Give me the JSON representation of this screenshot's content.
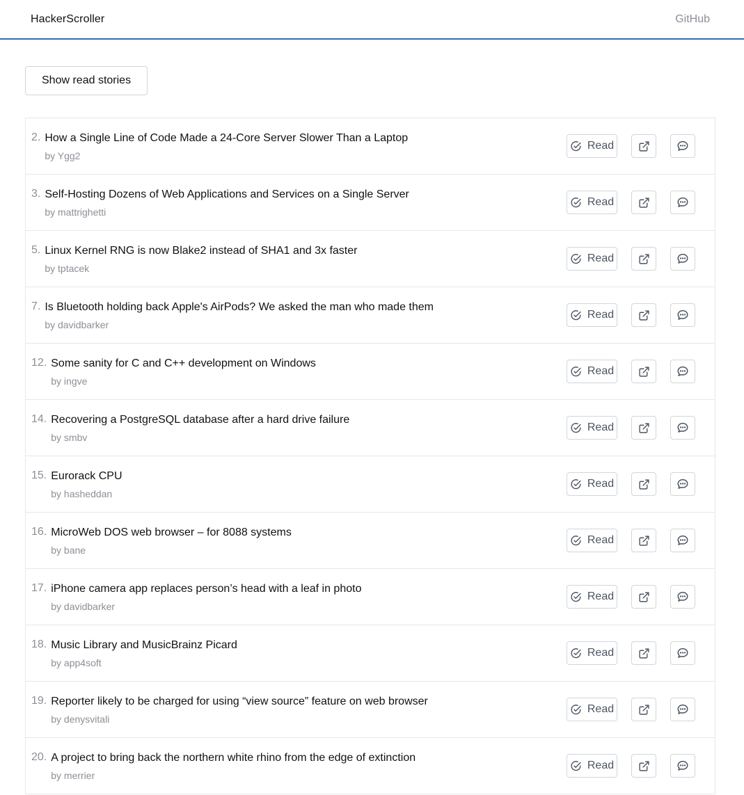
{
  "header": {
    "brand": "HackerScroller",
    "github_label": "GitHub"
  },
  "toolbar": {
    "toggle_label": "Show read stories"
  },
  "actions": {
    "read_label": "Read"
  },
  "stories": [
    {
      "rank": "2.",
      "title": "How a Single Line of Code Made a 24-Core Server Slower Than a Laptop",
      "author": "by Ygg2"
    },
    {
      "rank": "3.",
      "title": "Self-Hosting Dozens of Web Applications and Services on a Single Server",
      "author": "by mattrighetti"
    },
    {
      "rank": "5.",
      "title": "Linux Kernel RNG is now Blake2 instead of SHA1 and 3x faster",
      "author": "by tptacek"
    },
    {
      "rank": "7.",
      "title": "Is Bluetooth holding back Apple's AirPods? We asked the man who made them",
      "author": "by davidbarker"
    },
    {
      "rank": "12.",
      "title": "Some sanity for C and C++ development on Windows",
      "author": "by ingve"
    },
    {
      "rank": "14.",
      "title": "Recovering a PostgreSQL database after a hard drive failure",
      "author": "by smbv"
    },
    {
      "rank": "15.",
      "title": "Eurorack CPU",
      "author": "by hasheddan"
    },
    {
      "rank": "16.",
      "title": "MicroWeb DOS web browser – for 8088 systems",
      "author": "by bane"
    },
    {
      "rank": "17.",
      "title": "iPhone camera app replaces person’s head with a leaf in photo",
      "author": "by davidbarker"
    },
    {
      "rank": "18.",
      "title": "Music Library and MusicBrainz Picard",
      "author": "by app4soft"
    },
    {
      "rank": "19.",
      "title": "Reporter likely to be charged for using “view source” feature on web browser",
      "author": "by denysvitali"
    },
    {
      "rank": "20.",
      "title": "A project to bring back the northern white rhino from the edge of extinction",
      "author": "by merrier"
    }
  ],
  "icons": {
    "read": "check-circle-icon",
    "open": "external-link-icon",
    "comments": "comment-bubble-icon"
  }
}
